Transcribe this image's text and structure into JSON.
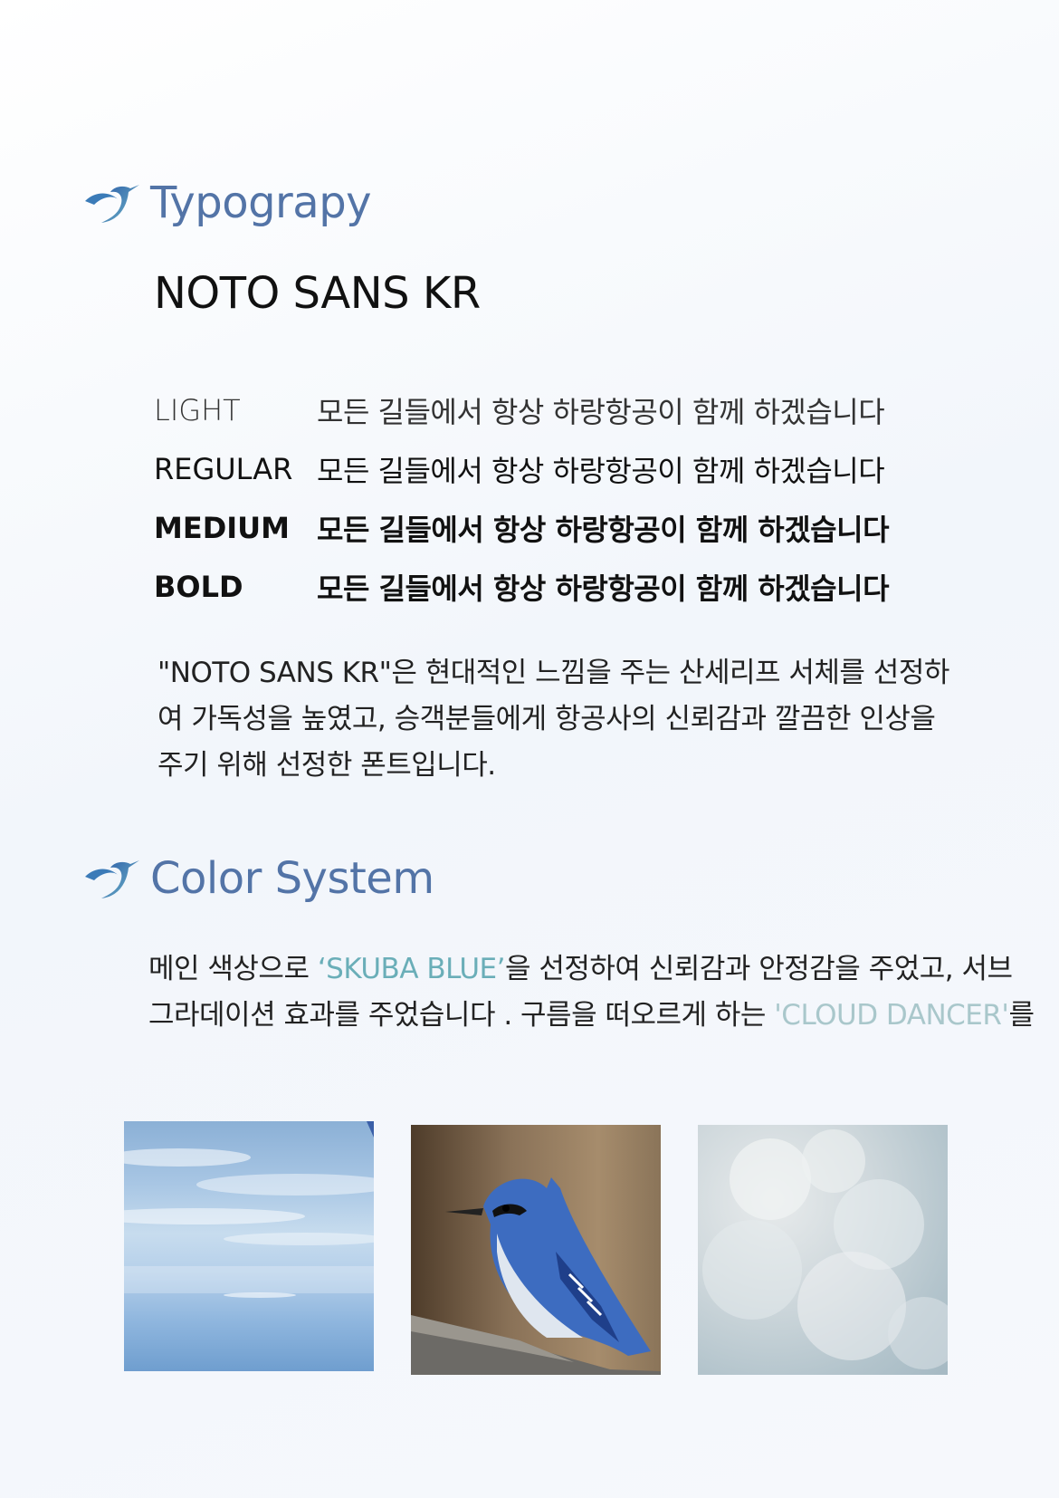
{
  "typography": {
    "heading": "Typograpy",
    "font_name": "NOTO SANS KR",
    "weights": [
      {
        "label": "LIGHT",
        "sample": "모든 길들에서 항상 하랑항공이 함께 하겠습니다"
      },
      {
        "label": "REGULAR",
        "sample": "모든 길들에서 항상 하랑항공이 함께 하겠습니다"
      },
      {
        "label": "MEDIUM",
        "sample": "모든 길들에서 항상 하랑항공이 함께 하겠습니다"
      },
      {
        "label": "BOLD",
        "sample": "모든 길들에서 항상 하랑항공이 함께 하겠습니다"
      }
    ],
    "description_lines": [
      "\"NOTO SANS KR\"은 현대적인 느낌을 주는 산세리프 서체를 선정하",
      "여 가독성을 높였고, 승객분들에게 항공사의 신뢰감과 깔끔한 인상을",
      "주기 위해 선정한 폰트입니다."
    ]
  },
  "color_system": {
    "heading": "Color System",
    "line1_a": "메인 색상으로 ",
    "line1_highlight": "‘SKUBA BLUE’",
    "line1_b": "을 선정하여 신뢰감과 안정감을 주었고, 서브",
    "line2_a": "그라데이션 효과를 주었습니다 . 구름을 떠오르게 하는 ",
    "line2_highlight": "'CLOUD DANCER'",
    "line2_b": "를",
    "highlight_colors": {
      "skuba_blue": "#6aaeb8",
      "cloud_dancer": "#a9c7cb"
    },
    "swatches": [
      {
        "name": "sky",
        "colors": [
          "#8bb0d6",
          "#c7dcee",
          "#6f9ecf"
        ]
      },
      {
        "name": "blue-jay",
        "colors": [
          "#4e3c2a",
          "#a68c6c",
          "#3d6cc0"
        ]
      },
      {
        "name": "clouds",
        "colors": [
          "#e8ebec",
          "#b3c4cc"
        ]
      }
    ]
  },
  "accent_color": "#5374a7"
}
